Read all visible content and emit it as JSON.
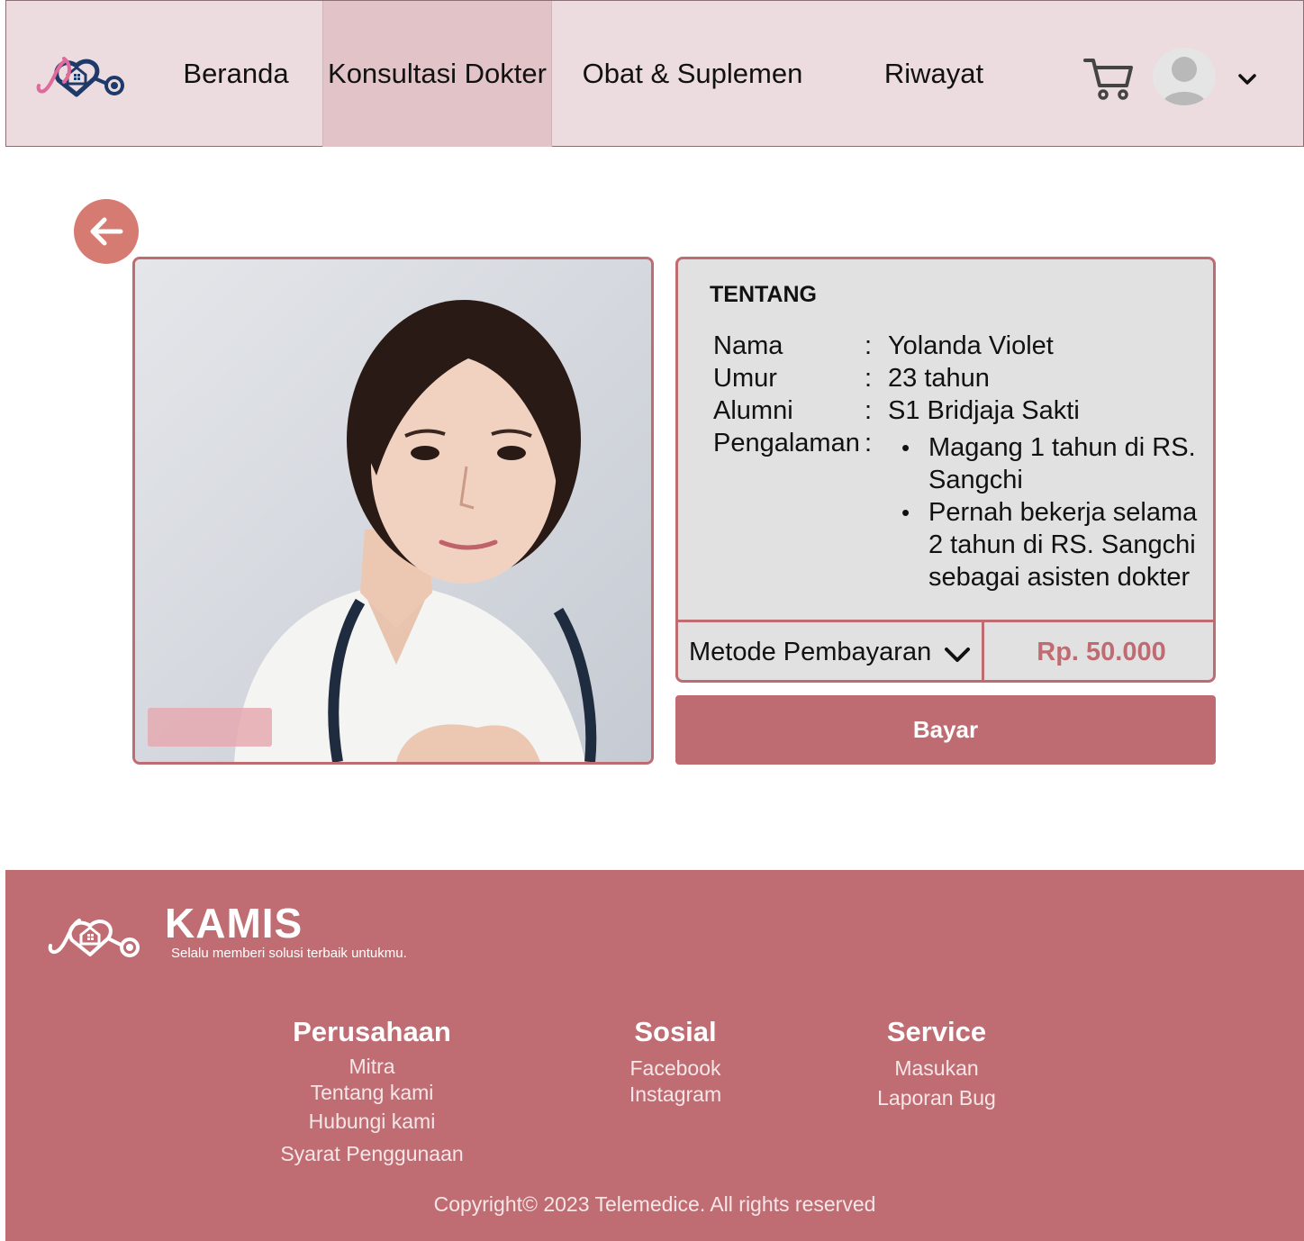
{
  "nav": {
    "items": [
      {
        "label": "Beranda"
      },
      {
        "label": "Konsultasi Dokter"
      },
      {
        "label": "Obat & Suplemen"
      },
      {
        "label": "Riwayat"
      }
    ],
    "active": "Konsultasi Dokter",
    "icons": [
      "logo-icon",
      "cart-icon",
      "avatar",
      "chevron-down-icon"
    ]
  },
  "back": {
    "icon": "arrow-left-icon"
  },
  "doctor": {
    "photo": "doctor-portrait",
    "section_title": "TENTANG",
    "fields": [
      {
        "label": "Nama",
        "value": "Yolanda Violet"
      },
      {
        "label": "Umur",
        "value": "23 tahun"
      },
      {
        "label": "Alumni",
        "value": "S1 Bridjaja Sakti"
      },
      {
        "label": "Pengalaman",
        "value": ""
      }
    ],
    "colon": ":",
    "experience": [
      "Magang 1 tahun di RS. Sangchi",
      "Pernah bekerja selama 2 tahun di RS. Sangchi sebagai asisten dokter"
    ]
  },
  "payment": {
    "method_label": "Metode Pembayaran",
    "price": "Rp. 50.000",
    "pay_button": "Bayar"
  },
  "footer": {
    "brand": "KAMIS",
    "tagline": "Selalu memberi solusi terbaik untukmu.",
    "columns": [
      {
        "title": "Perusahaan",
        "links": [
          "Mitra",
          "Tentang kami",
          "Hubungi kami",
          "Syarat Penggunaan"
        ]
      },
      {
        "title": "Sosial",
        "links": [
          "Facebook",
          "Instagram"
        ]
      },
      {
        "title": "Service",
        "links": [
          "Masukan",
          "Laporan Bug"
        ]
      }
    ],
    "copyright": "Copyright© 2023 Telemedice. All rights reserved"
  },
  "colors": {
    "accent": "#bf6b72",
    "nav_bg": "#eddcdf",
    "nav_active": "#e2c4c8",
    "back_button": "#d67b72",
    "card_bg": "#e1e1e1"
  }
}
